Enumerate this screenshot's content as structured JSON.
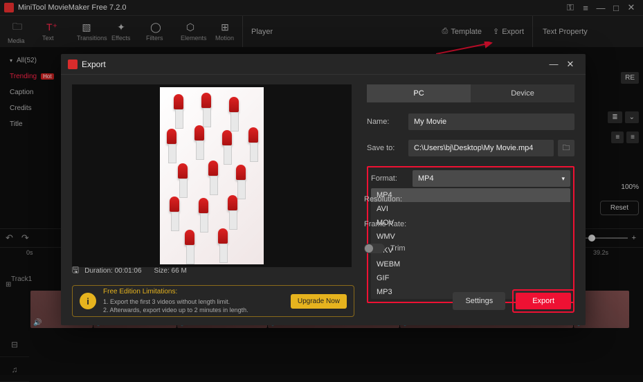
{
  "title": "MiniTool MovieMaker Free 7.2.0",
  "toolbar": {
    "media": "Media",
    "text": "Text",
    "transitions": "Transitions",
    "effects": "Effects",
    "filters": "Filters",
    "elements": "Elements",
    "motion": "Motion"
  },
  "playerbar": {
    "player": "Player",
    "template": "Template",
    "export": "Export"
  },
  "textprop": "Text Property",
  "sidebar": {
    "all": "All(52)",
    "trending": "Trending",
    "hot": "Hot",
    "caption": "Caption",
    "credits": "Credits",
    "title": "Title"
  },
  "rprops": {
    "re": "RE",
    "zoom": "100%",
    "reset": "Reset"
  },
  "timeline": {
    "t0": "0s",
    "t39": "39.2s",
    "track1": "Track1"
  },
  "export": {
    "title": "Export",
    "tab_pc": "PC",
    "tab_device": "Device",
    "name_label": "Name:",
    "name_value": "My Movie",
    "saveto_label": "Save to:",
    "saveto_value": "C:\\Users\\bj\\Desktop\\My Movie.mp4",
    "format_label": "Format:",
    "format_value": "MP4",
    "options": [
      "MP4",
      "AVI",
      "MOV",
      "WMV",
      "MKV",
      "WEBM",
      "GIF",
      "MP3"
    ],
    "resolution_label": "Resolution:",
    "framerate_label": "Frame Rate:",
    "trim_label": "Trim",
    "duration_label": "Duration:",
    "duration_value": "00:01:06",
    "size_label": "Size:",
    "size_value": "66 M",
    "free_title": "Free Edition Limitations:",
    "free_l1": "1. Export the first 3 videos without length limit.",
    "free_l2": "2. Afterwards, export video up to 2 minutes in length.",
    "upgrade": "Upgrade Now",
    "settings": "Settings",
    "export_btn": "Export"
  }
}
